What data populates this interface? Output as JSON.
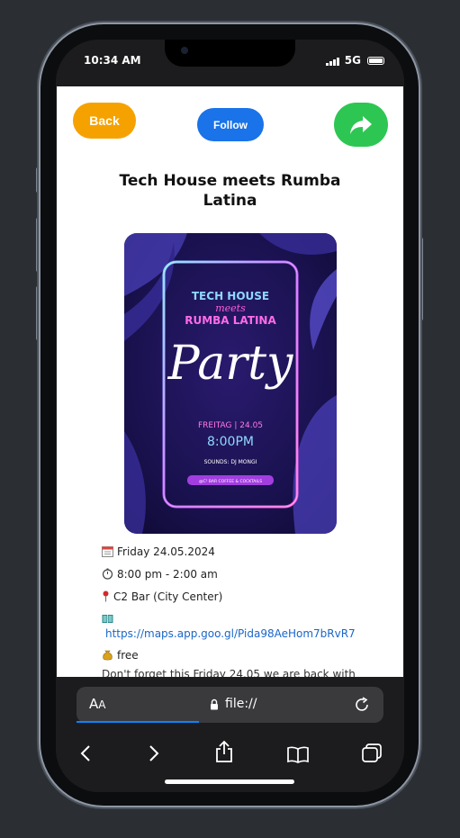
{
  "status": {
    "time": "10:34 AM",
    "network": "5G"
  },
  "header": {
    "back_label": "Back",
    "follow_label": "Follow"
  },
  "event": {
    "title": "Tech House meets Rumba Latina",
    "date": "Friday 24.05.2024",
    "time": "8:00 pm - 2:00 am",
    "location": "C2 Bar (City Center)",
    "map_link": "https://maps.app.goo.gl/Pida98AeHom7bRvR7",
    "price": "free",
    "description": "Don't forget this Friday 24.05 we are back with"
  },
  "poster": {
    "line1": "TECH HOUSE",
    "line2": "meets",
    "line3": "RUMBA LATINA",
    "script": "Party",
    "day": "FREITAG | 24.05",
    "hour": "8:00PM",
    "sounds": "SOUNDS: DJ MONGI",
    "venue": "@C² BAR COFFEE & COCKTAILS"
  },
  "browser": {
    "aa_label": "A",
    "aa_small": "A",
    "url": "file://",
    "load_progress": 0.4
  },
  "icons": {
    "calendar": "calendar-icon",
    "clock": "stopwatch-icon",
    "location": "pin-icon",
    "map": "map-book-icon",
    "price": "money-bag-icon",
    "share": "share-arrow-icon"
  },
  "colors": {
    "back": "#f5a200",
    "follow": "#1a73e8",
    "share": "#2dc653",
    "link": "#1a66c9"
  }
}
